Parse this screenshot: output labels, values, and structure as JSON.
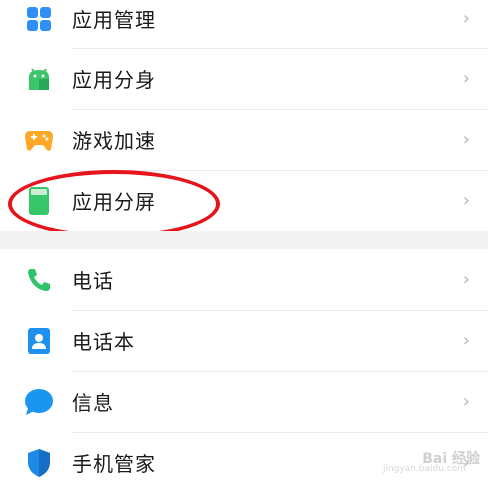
{
  "settings": {
    "items": [
      {
        "label": "应用管理",
        "icon": "app-grid-icon",
        "color": "#2f8ff5"
      },
      {
        "label": "应用分身",
        "icon": "android-clone-icon",
        "color": "#3cc66b"
      },
      {
        "label": "游戏加速",
        "icon": "gamepad-icon",
        "color": "#ffa826"
      },
      {
        "label": "应用分屏",
        "icon": "split-screen-icon",
        "color": "#38c66a"
      },
      {
        "label": "电话",
        "icon": "phone-icon",
        "color": "#2fc36a"
      },
      {
        "label": "电话本",
        "icon": "contacts-icon",
        "color": "#1e90f0"
      },
      {
        "label": "信息",
        "icon": "message-icon",
        "color": "#1a96f0"
      },
      {
        "label": "手机管家",
        "icon": "shield-icon",
        "color": "#1e8ae8"
      }
    ],
    "chevron": "›"
  },
  "watermark": {
    "text": "Bai 经验",
    "sub": "jingyan.baidu.com"
  },
  "colors": {
    "highlight": "#e8141c"
  }
}
